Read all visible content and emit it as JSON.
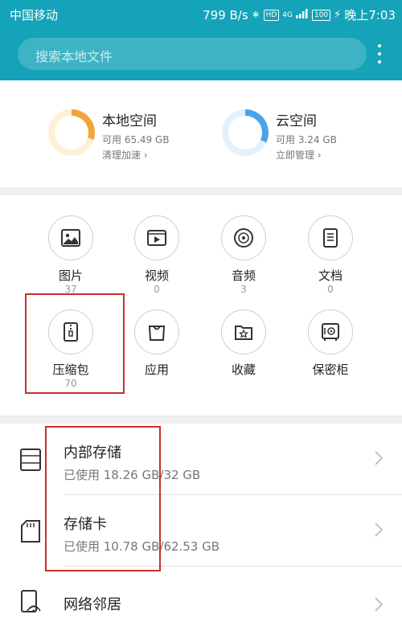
{
  "status_bar": {
    "carrier": "中国移动",
    "speed": "799 B/s",
    "hd_badge": "HD",
    "network": "4G",
    "battery": "100",
    "time": "晚上7:03"
  },
  "search": {
    "placeholder": "搜索本地文件"
  },
  "storage": {
    "local": {
      "title": "本地空间",
      "available": "可用 65.49 GB",
      "action": "清理加速",
      "used_fraction": 0.3
    },
    "cloud": {
      "title": "云空间",
      "available": "可用 3.24 GB",
      "action": "立即管理",
      "used_fraction": 0.32
    }
  },
  "categories": [
    {
      "label": "图片",
      "count": "37",
      "icon": "image-icon"
    },
    {
      "label": "视频",
      "count": "0",
      "icon": "video-icon"
    },
    {
      "label": "音频",
      "count": "3",
      "icon": "audio-icon"
    },
    {
      "label": "文档",
      "count": "0",
      "icon": "document-icon"
    },
    {
      "label": "压缩包",
      "count": "70",
      "icon": "zip-icon"
    },
    {
      "label": "应用",
      "count": "",
      "icon": "app-bag-icon"
    },
    {
      "label": "收藏",
      "count": "",
      "icon": "favorite-star-icon"
    },
    {
      "label": "保密柜",
      "count": "",
      "icon": "safe-icon"
    }
  ],
  "locations": [
    {
      "title": "内部存储",
      "usage": "已使用 18.26 GB/32 GB",
      "icon": "internal-storage-icon"
    },
    {
      "title": "存储卡",
      "usage": "已使用 10.78 GB/62.53 GB",
      "icon": "sd-card-icon"
    },
    {
      "title": "网络邻居",
      "usage": "",
      "icon": "network-neighborhood-icon"
    }
  ],
  "colors": {
    "header": "#14a3b8",
    "local_ring": "#f3a53a",
    "cloud_ring": "#4aa3e8",
    "highlight": "#c8302c"
  }
}
